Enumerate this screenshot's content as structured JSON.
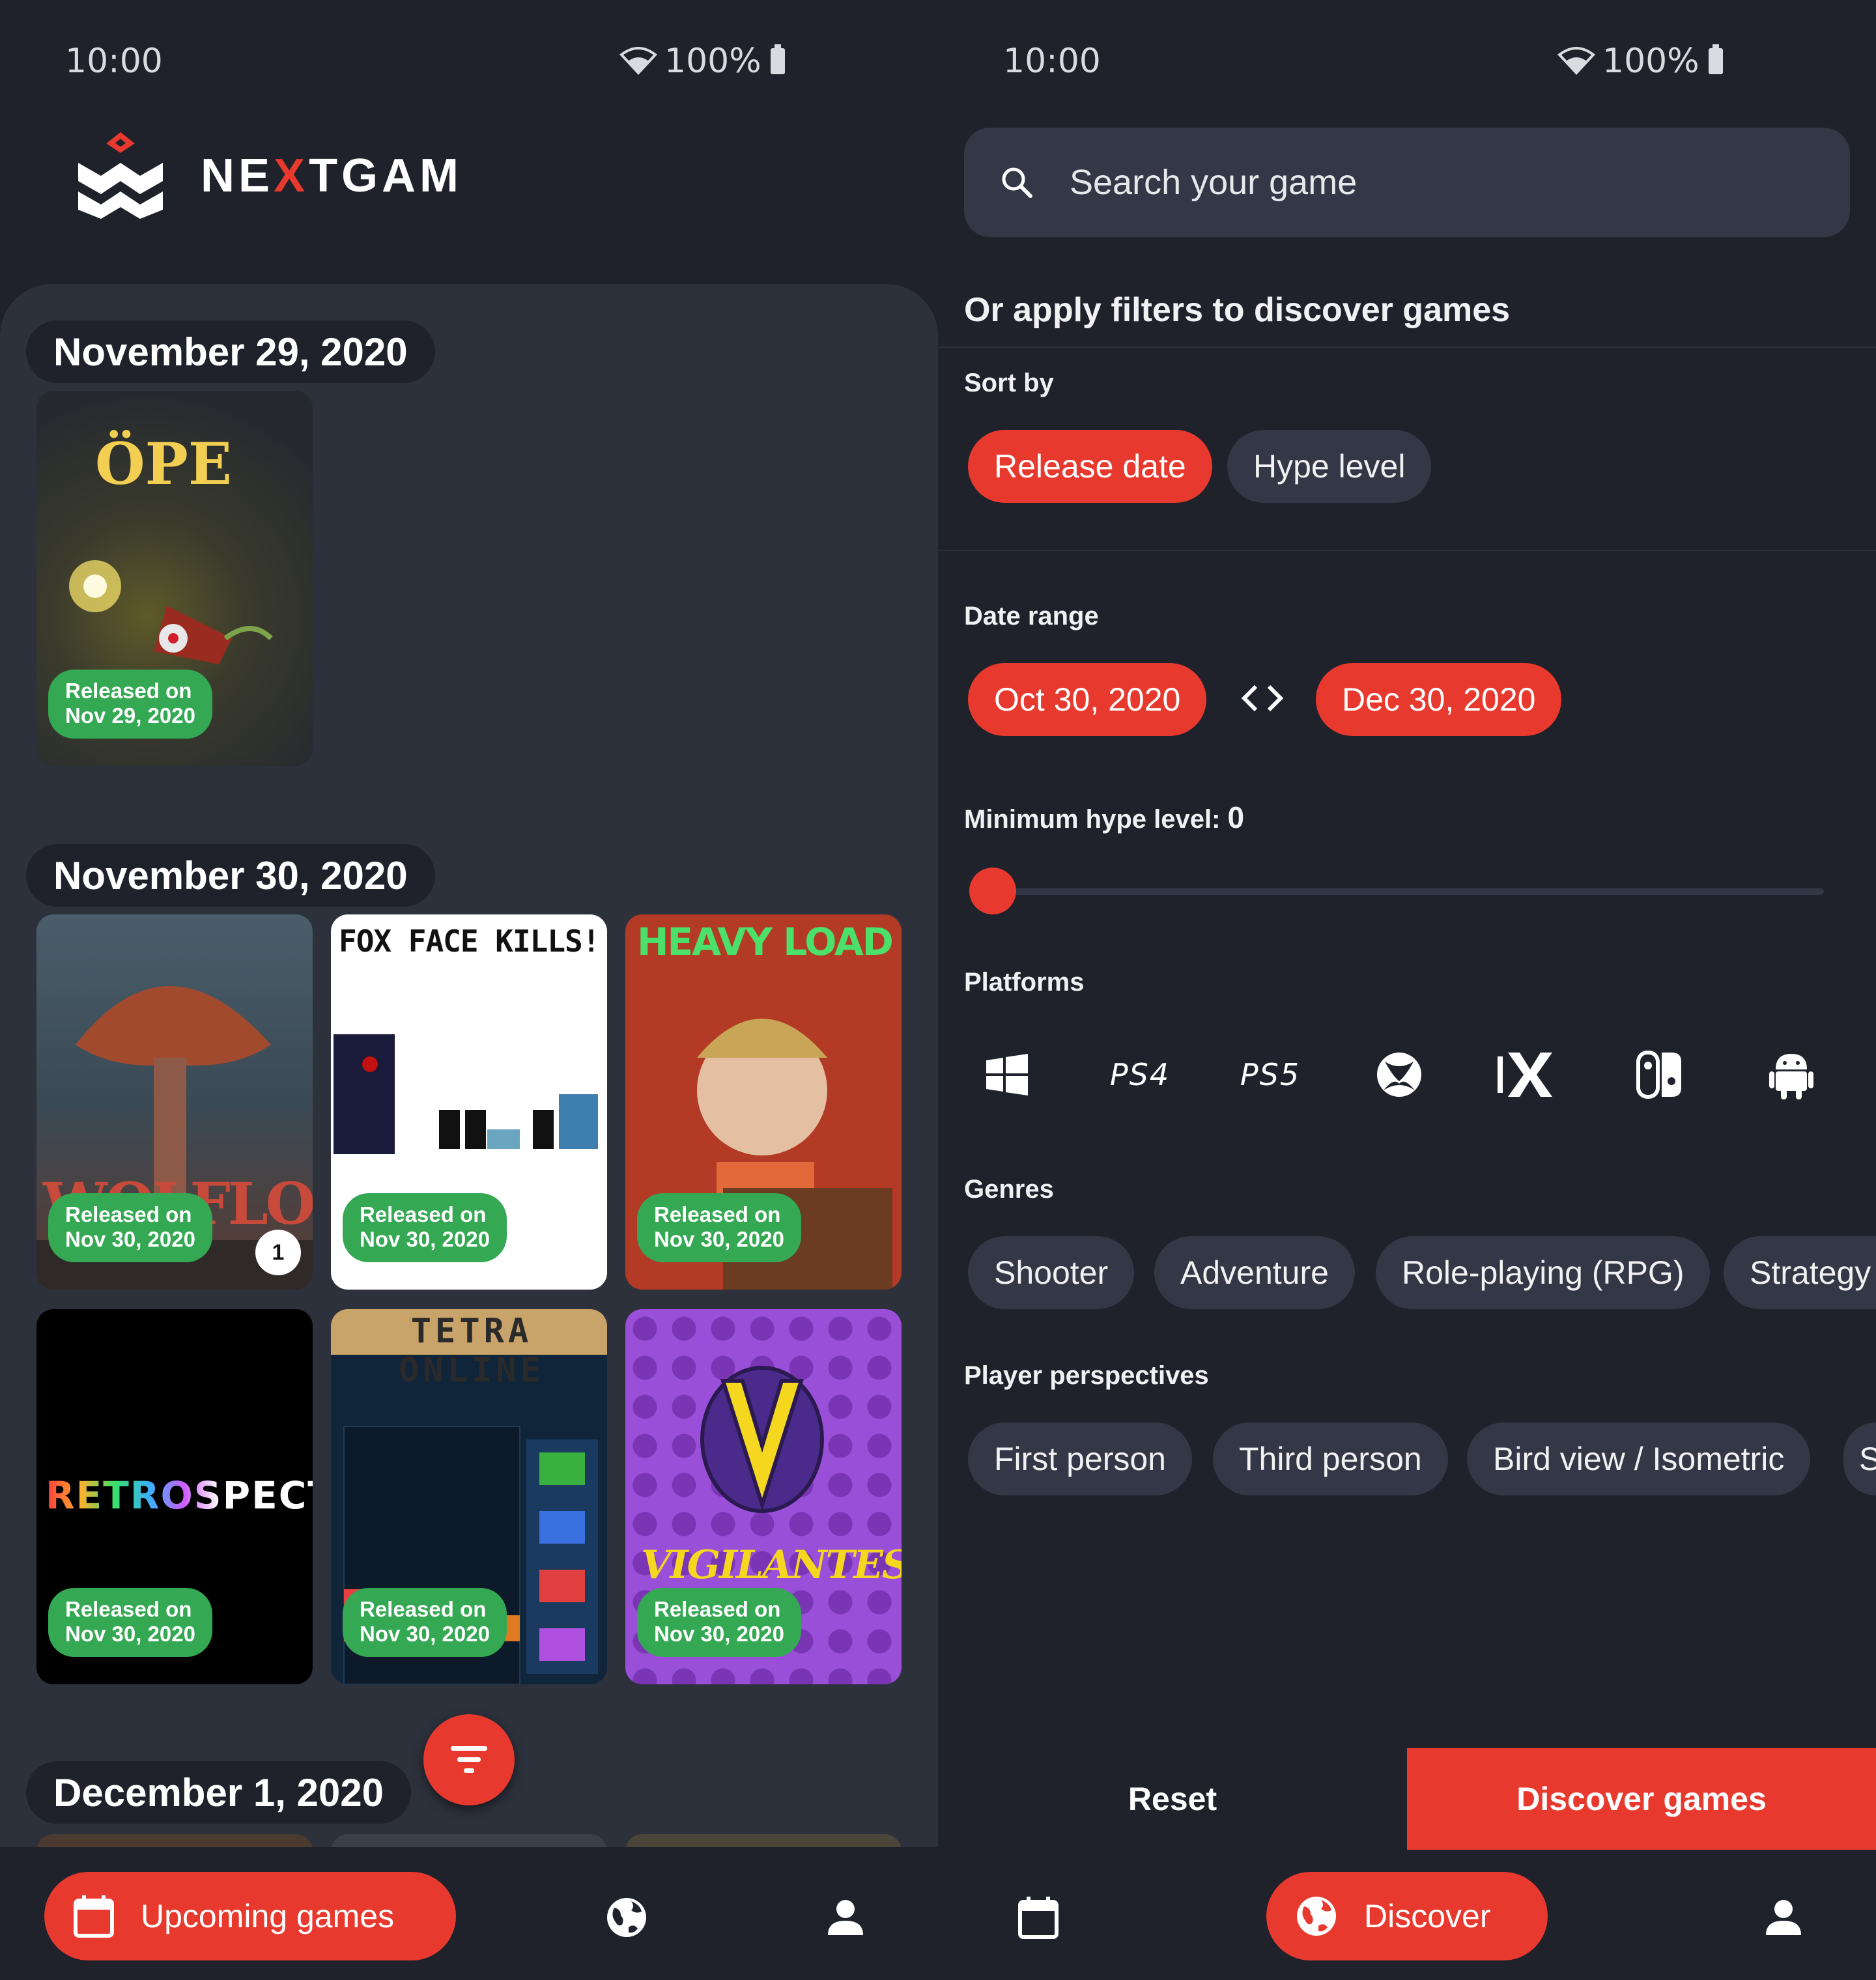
{
  "left": {
    "status": {
      "time": "10:00",
      "battery": "100%"
    },
    "app": {
      "brand": "NEXTGAM"
    },
    "sections": [
      {
        "date": "November 29, 2020",
        "games": [
          {
            "title": "ÖPE",
            "release": [
              "Released on",
              "Nov 29, 2020"
            ]
          }
        ]
      },
      {
        "date": "November 30, 2020",
        "games": [
          {
            "title": "WOLFLORD",
            "release": [
              "Released on",
              "Nov 30, 2020"
            ],
            "count": "1"
          },
          {
            "title": "FOX FACE KILLS!",
            "release": [
              "Released on",
              "Nov 30, 2020"
            ]
          },
          {
            "title": "HEAVY LOAD",
            "release": [
              "Released on",
              "Nov 30, 2020"
            ]
          },
          {
            "title": "RETROSPECT",
            "release": [
              "Released on",
              "Nov 30, 2020"
            ]
          },
          {
            "title": "TETRA ONLINE",
            "release": [
              "Released on",
              "Nov 30, 2020"
            ]
          },
          {
            "title": "VIGILANTES",
            "release": [
              "Released on",
              "Nov 30, 2020"
            ]
          }
        ]
      },
      {
        "date": "December 1, 2020"
      }
    ],
    "nav": {
      "active_label": "Upcoming games"
    }
  },
  "right": {
    "status": {
      "time": "10:00",
      "battery": "100%"
    },
    "search": {
      "placeholder": "Search your game"
    },
    "filters_title": "Or apply filters to discover games",
    "sort": {
      "label": "Sort by",
      "options": [
        "Release date",
        "Hype level"
      ],
      "selected": "Release date"
    },
    "date_range": {
      "label": "Date range",
      "from": "Oct 30, 2020",
      "to": "Dec 30, 2020"
    },
    "hype": {
      "label": "Minimum hype level:",
      "value": "0"
    },
    "platforms": {
      "label": "Platforms",
      "items": [
        "windows-icon",
        "ps4-icon",
        "ps5-icon",
        "xbox-icon",
        "xbox-series-x-icon",
        "switch-icon",
        "android-icon"
      ],
      "ps4_text": "PS4",
      "ps5_text": "PS5"
    },
    "genres": {
      "label": "Genres",
      "items": [
        "Shooter",
        "Adventure",
        "Role-playing (RPG)",
        "Strategy"
      ]
    },
    "perspectives": {
      "label": "Player perspectives",
      "items": [
        "First person",
        "Third person",
        "Bird view / Isometric",
        "S"
      ]
    },
    "actions": {
      "reset": "Reset",
      "discover": "Discover games"
    },
    "nav": {
      "active_label": "Discover"
    }
  },
  "colors": {
    "accent": "#e8392e",
    "badge": "#34a853",
    "bg": "#1f222a",
    "surface": "#2d313c",
    "chip": "#343846"
  }
}
